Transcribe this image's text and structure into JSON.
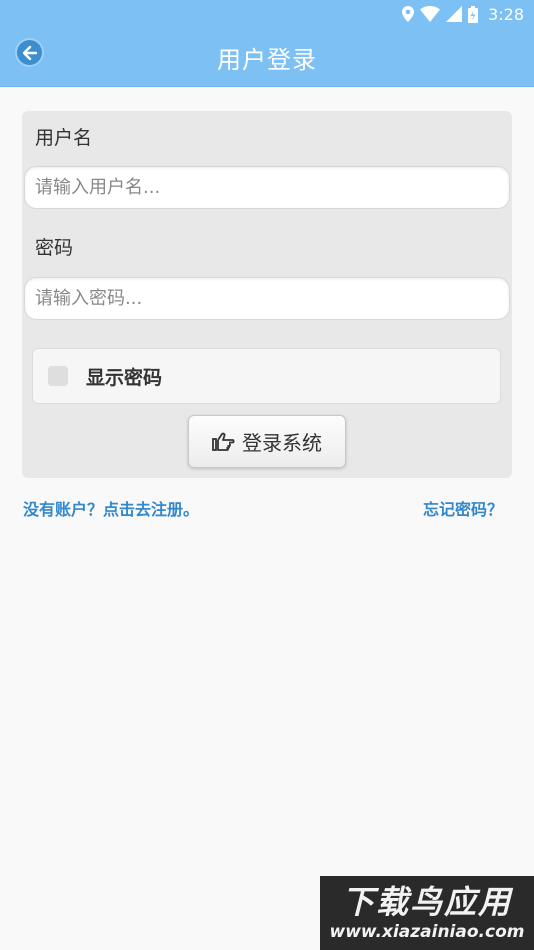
{
  "status_bar": {
    "time": "3:28",
    "icons": [
      "location-icon",
      "wifi-icon",
      "signal-icon",
      "battery-charging-icon"
    ]
  },
  "header": {
    "title": "用户登录",
    "back_icon": "arrow-left-icon"
  },
  "form": {
    "username_label": "用户名",
    "username_placeholder": "请输入用户名...",
    "username_value": "",
    "password_label": "密码",
    "password_placeholder": "请输入密码...",
    "password_value": "",
    "show_password_label": "显示密码",
    "show_password_checked": false,
    "login_label": "登录系统",
    "login_icon": "hand-pointing-icon"
  },
  "links": {
    "register": "没有账户？点击去注册。",
    "forgot": "忘记密码？"
  },
  "watermark": {
    "title": "下载鸟应用",
    "url": "www.xiazainiao.com"
  },
  "colors": {
    "header_bg": "#7cc0f4",
    "link": "#3388cc",
    "panel_bg": "#e8e8e8",
    "page_bg": "#f9f9f9"
  }
}
